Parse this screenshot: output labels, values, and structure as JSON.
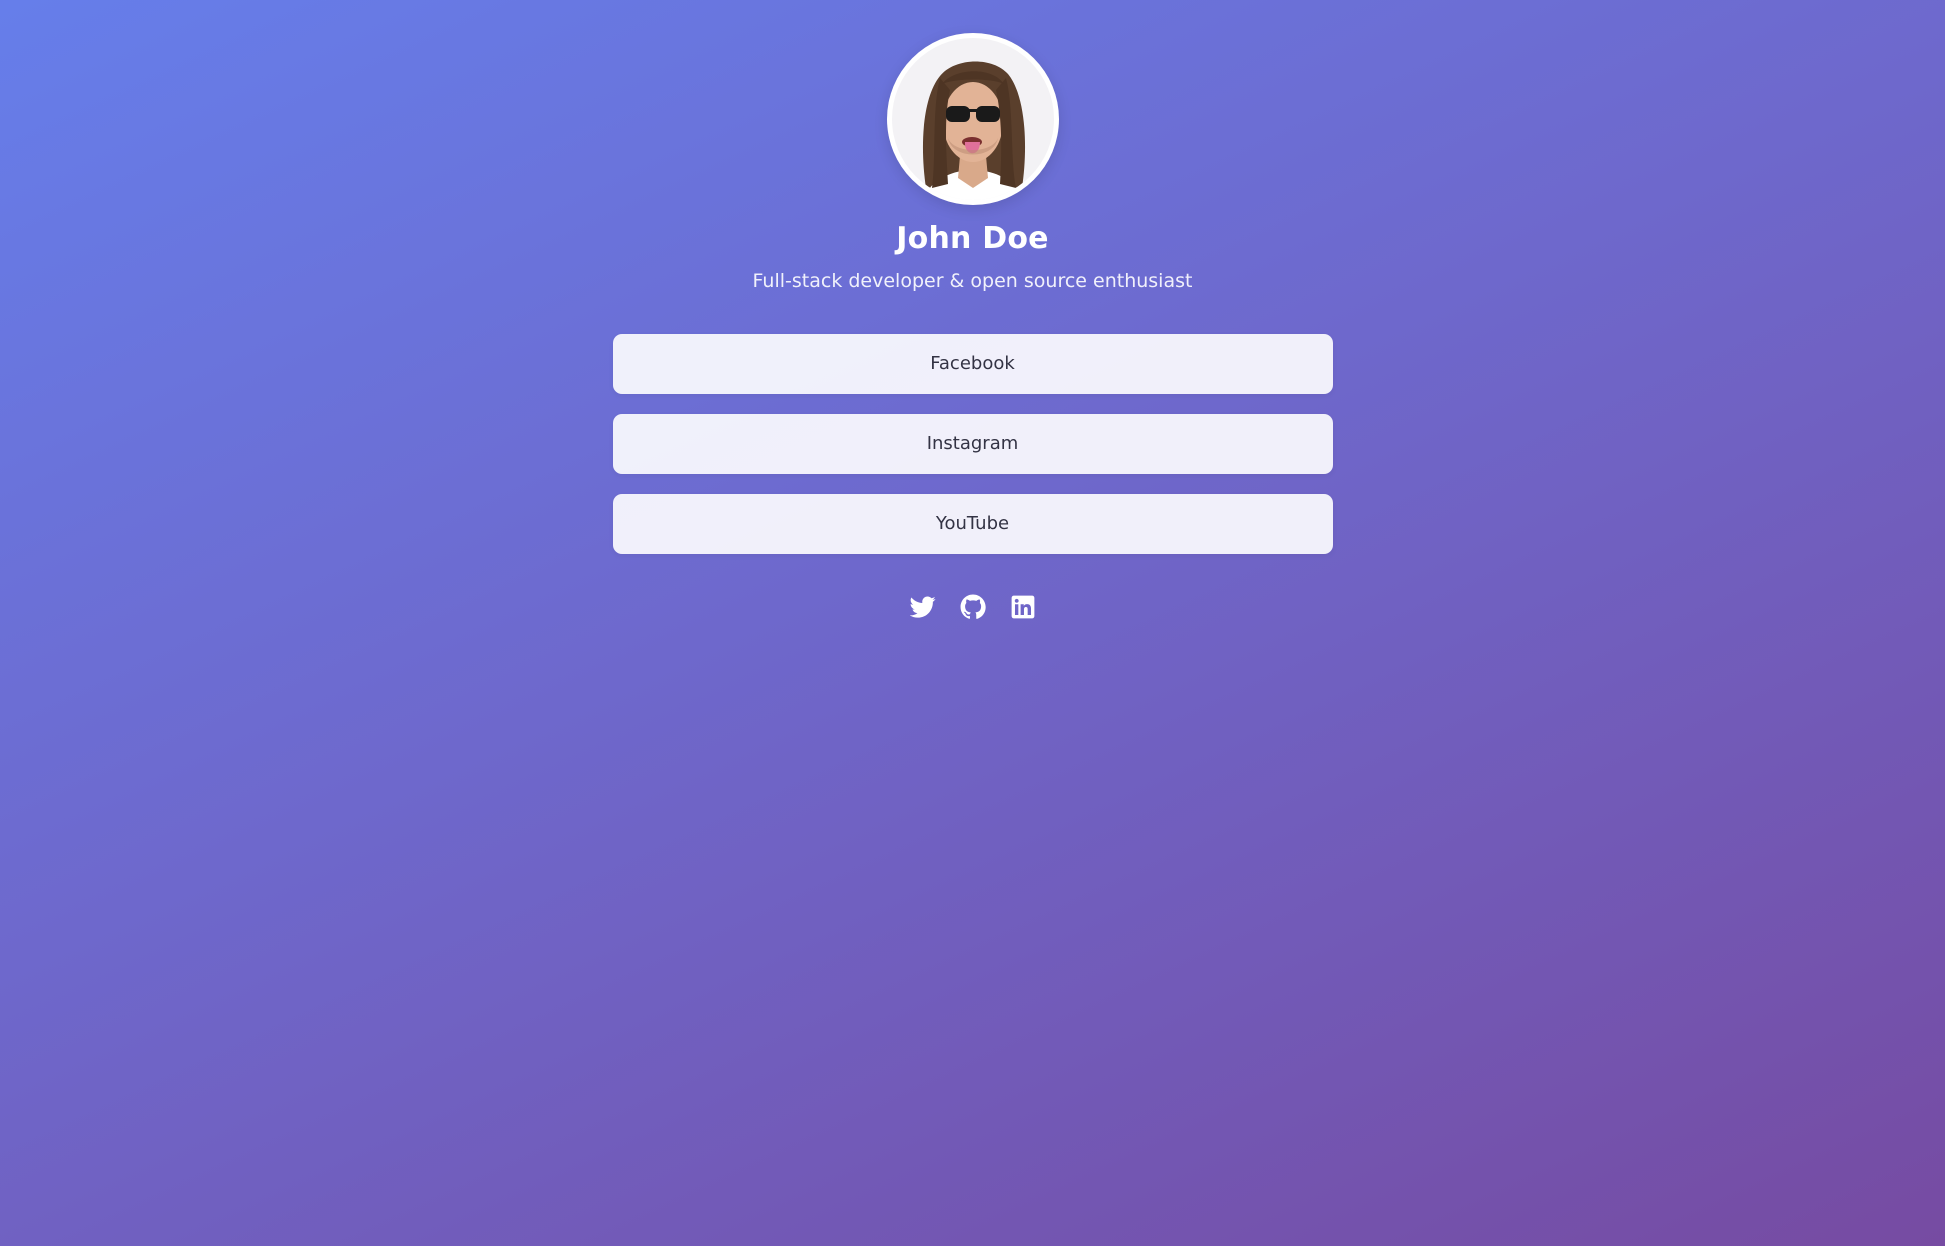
{
  "profile": {
    "name": "John Doe",
    "bio": "Full-stack developer & open source enthusiast",
    "avatar_icon": "avatar-photo"
  },
  "links": [
    {
      "label": "Facebook"
    },
    {
      "label": "Instagram"
    },
    {
      "label": "YouTube"
    }
  ],
  "socials": [
    {
      "icon": "twitter-icon"
    },
    {
      "icon": "github-icon"
    },
    {
      "icon": "linkedin-icon"
    }
  ],
  "colors": {
    "gradient_start": "#667eea",
    "gradient_end": "#764ba2",
    "button_bg": "#f2f0fa",
    "button_text": "#333344",
    "text": "#ffffff"
  }
}
